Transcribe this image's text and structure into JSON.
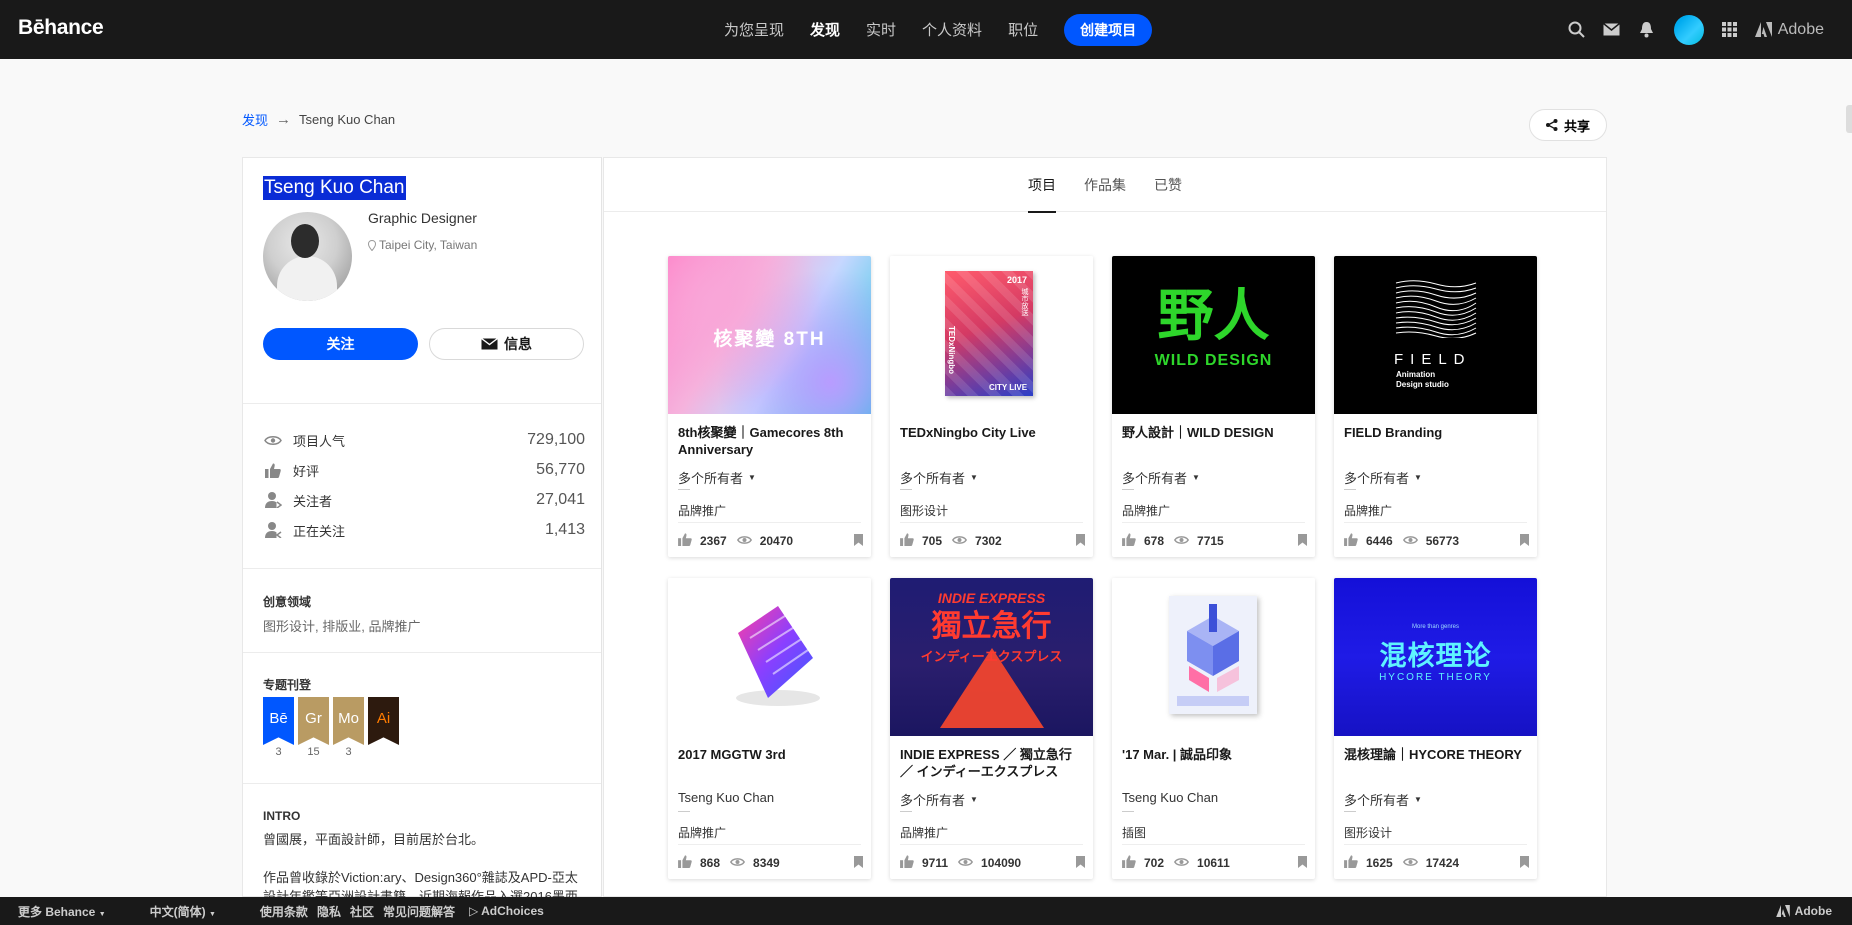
{
  "header": {
    "logo": "Bēhance",
    "nav": [
      "为您呈现",
      "发现",
      "实时",
      "个人资料",
      "职位"
    ],
    "create": "创建项目",
    "adobe": "Adobe"
  },
  "breadcrumb": {
    "link": "发现",
    "arrow": "→",
    "current": "Tseng Kuo Chan"
  },
  "share": "共享",
  "profile": {
    "name": "Tseng Kuo Chan",
    "role": "Graphic Designer",
    "location": "Taipei City, Taiwan",
    "follow": "关注",
    "message": "信息",
    "stats": [
      {
        "label": "项目人气",
        "value": "729,100",
        "icon": "eye-icon"
      },
      {
        "label": "好评",
        "value": "56,770",
        "icon": "thumbs-up-icon"
      },
      {
        "label": "关注者",
        "value": "27,041",
        "icon": "followers-icon"
      },
      {
        "label": "正在关注",
        "value": "1,413",
        "icon": "following-icon"
      }
    ],
    "fields_title": "创意领域",
    "fields": "图形设计, 排版业, 品牌推广",
    "featured_title": "专题刊登",
    "badges": [
      {
        "label": "Bē",
        "count": "3",
        "color": "#0057ff",
        "text_color": "#ffffff"
      },
      {
        "label": "Gr",
        "count": "15",
        "color": "#b99b63",
        "text_color": "#ffffff"
      },
      {
        "label": "Mo",
        "count": "3",
        "color": "#b99b63",
        "text_color": "#ffffff"
      },
      {
        "label": "Ai",
        "count": "",
        "color": "#2d1a0e",
        "text_color": "#ff7c00"
      }
    ],
    "intro_title": "INTRO",
    "intro_line1": "曾國展，平面設計師，目前居於台北。",
    "intro_line2": "作品曾收錄於Viction:ary、Design360°雜誌及APD-亞太設計年鑑等亞洲設計書籍，近期海報作品入選2016墨西"
  },
  "tabs": [
    "项目",
    "作品集",
    "已赞"
  ],
  "projects": [
    {
      "title": "8th核聚變｜Gamecores 8th Anniversary",
      "owner": "多个所有者",
      "owner_dropdown": true,
      "category": "品牌推广",
      "likes": "2367",
      "views": "20470"
    },
    {
      "title": "TEDxNingbo City Live",
      "owner": "多个所有者",
      "owner_dropdown": true,
      "category": "图形设计",
      "likes": "705",
      "views": "7302"
    },
    {
      "title": "野人設計｜WILD DESIGN",
      "owner": "多个所有者",
      "owner_dropdown": true,
      "category": "品牌推广",
      "likes": "678",
      "views": "7715"
    },
    {
      "title": "FIELD Branding",
      "owner": "多个所有者",
      "owner_dropdown": true,
      "category": "品牌推广",
      "likes": "6446",
      "views": "56773"
    },
    {
      "title": "2017 MGGTW 3rd",
      "owner": "Tseng Kuo Chan",
      "owner_dropdown": false,
      "category": "品牌推广",
      "likes": "868",
      "views": "8349"
    },
    {
      "title": "INDIE EXPRESS ／ 獨立急行 ／ インディーエクスプレス",
      "owner": "多个所有者",
      "owner_dropdown": true,
      "category": "品牌推广",
      "likes": "9711",
      "views": "104090"
    },
    {
      "title": "'17 Mar. | 誠品印象",
      "owner": "Tseng Kuo Chan",
      "owner_dropdown": false,
      "category": "插图",
      "likes": "702",
      "views": "10611"
    },
    {
      "title": "混核理論｜HYCORE THEORY",
      "owner": "多个所有者",
      "owner_dropdown": true,
      "category": "图形设计",
      "likes": "1625",
      "views": "17424"
    }
  ],
  "thumb_text": {
    "gamecores": "核聚變 8TH",
    "ted_year": "2017",
    "ted_city": "城市放送",
    "ted_name": "TEDxNingbo",
    "ted_live": "CITY LIVE",
    "wild_cn": "野人",
    "wild_en": "WILD DESIGN",
    "field": "FIELD",
    "field_sub1": "Animation",
    "field_sub2": "Design studio",
    "indie_en": "INDIE EXPRESS",
    "indie_cn": "獨立急行",
    "indie_jp": "インディーエクスプレス",
    "hycore_small": "More than genres",
    "hycore_cn": "混核理论",
    "hycore_en": "HYCORE THEORY"
  },
  "footer": {
    "more": "更多 Behance",
    "lang": "中文(简体)",
    "links": [
      "使用条款",
      "隐私",
      "社区",
      "常见问题解答"
    ],
    "adchoices": "AdChoices",
    "adobe": "Adobe"
  }
}
